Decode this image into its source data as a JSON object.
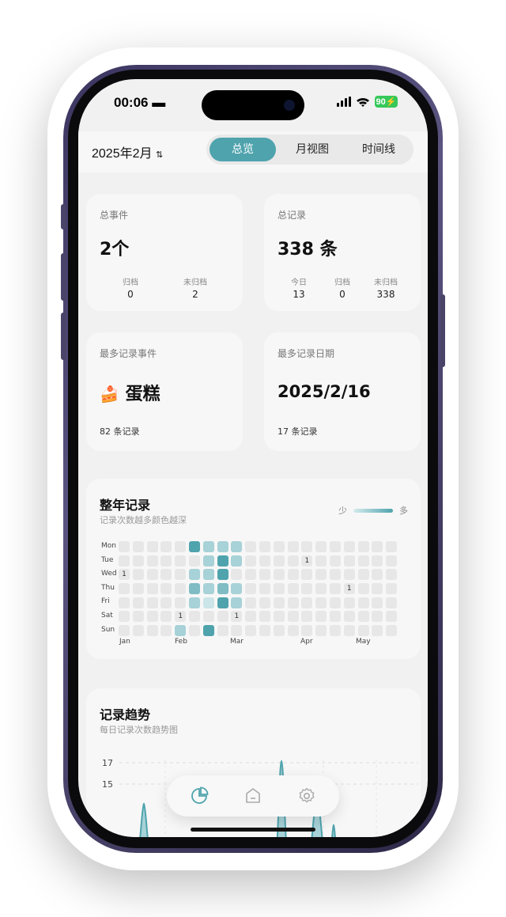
{
  "status": {
    "time": "00:06",
    "battery": "90"
  },
  "header": {
    "month": "2025年2月",
    "tabs": [
      "总览",
      "月视图",
      "时间线"
    ]
  },
  "events_card": {
    "label": "总事件",
    "value": "2个",
    "stats": [
      {
        "label": "归档",
        "value": "0"
      },
      {
        "label": "未归档",
        "value": "2"
      }
    ]
  },
  "records_card": {
    "label": "总记录",
    "value": "338 条",
    "stats": [
      {
        "label": "今日",
        "value": "13"
      },
      {
        "label": "归档",
        "value": "0"
      },
      {
        "label": "未归档",
        "value": "338"
      }
    ]
  },
  "top_event_card": {
    "label": "最多记录事件",
    "emoji": "🍰",
    "name": "蛋糕",
    "count": "82 条记录"
  },
  "top_date_card": {
    "label": "最多记录日期",
    "date": "2025/2/16",
    "count": "17 条记录"
  },
  "heatmap": {
    "title": "整年记录",
    "subtitle": "记录次数越多颜色越深",
    "legend_low": "少",
    "legend_high": "多",
    "days": [
      "Mon",
      "Tue",
      "Wed",
      "Thu",
      "Fri",
      "Sat",
      "Sun"
    ],
    "months": [
      "Jan",
      "Feb",
      "Mar",
      "Apr",
      "May"
    ],
    "cells": [
      [
        0,
        0,
        0,
        0,
        0,
        4,
        2,
        2,
        2,
        0,
        0,
        0,
        0,
        0,
        0,
        0,
        0,
        0,
        0,
        0
      ],
      [
        0,
        0,
        0,
        0,
        0,
        0,
        2,
        4,
        2,
        0,
        0,
        0,
        0,
        "1",
        0,
        0,
        0,
        0,
        0,
        0
      ],
      [
        "1",
        0,
        0,
        0,
        0,
        2,
        2,
        4,
        0,
        0,
        0,
        0,
        0,
        0,
        0,
        0,
        0,
        0,
        0,
        0
      ],
      [
        0,
        0,
        0,
        0,
        0,
        3,
        2,
        3,
        2,
        0,
        0,
        0,
        0,
        0,
        0,
        0,
        "1",
        0,
        0,
        0
      ],
      [
        0,
        0,
        0,
        0,
        0,
        2,
        1,
        4,
        2,
        0,
        0,
        0,
        0,
        0,
        0,
        0,
        0,
        0,
        0,
        0
      ],
      [
        0,
        0,
        0,
        0,
        "1",
        0,
        0,
        0,
        "1",
        0,
        0,
        0,
        0,
        0,
        0,
        0,
        0,
        0,
        0,
        0
      ],
      [
        0,
        0,
        0,
        0,
        2,
        0,
        4,
        0,
        0,
        0,
        0,
        0,
        0,
        0,
        0,
        0,
        0,
        0,
        0,
        0
      ]
    ],
    "colors": {
      "0": "#e7e7e7",
      "1": "#cbe5e8",
      "2": "#a7d2d7",
      "3": "#7fbcc4",
      "4": "#4fa3ad"
    }
  },
  "trend": {
    "title": "记录趋势",
    "subtitle": "每日记录次数趋势图",
    "y_ticks": [
      "17",
      "15"
    ]
  },
  "tabbar": {
    "icons": [
      "pie-chart-icon",
      "home-icon",
      "settings-icon"
    ]
  }
}
